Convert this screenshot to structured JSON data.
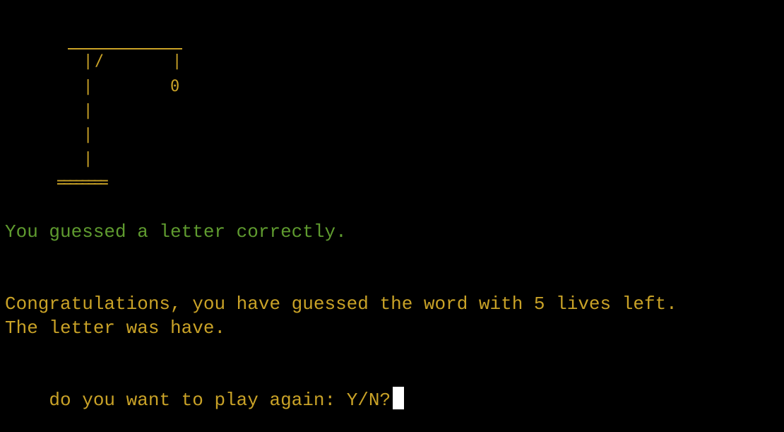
{
  "hangman": {
    "slash": "/",
    "head": "0",
    "base": "========"
  },
  "messages": {
    "guess_result": "You guessed a letter correctly.",
    "congrats": "Congratulations, you have guessed the word with 5 lives left.",
    "reveal": "The letter was have.",
    "prompt": "do you want to play again: Y/N?"
  },
  "colors": {
    "background": "#000000",
    "text_yellow": "#c9a227",
    "text_green": "#5f9b2f",
    "cursor": "#ffffff"
  }
}
